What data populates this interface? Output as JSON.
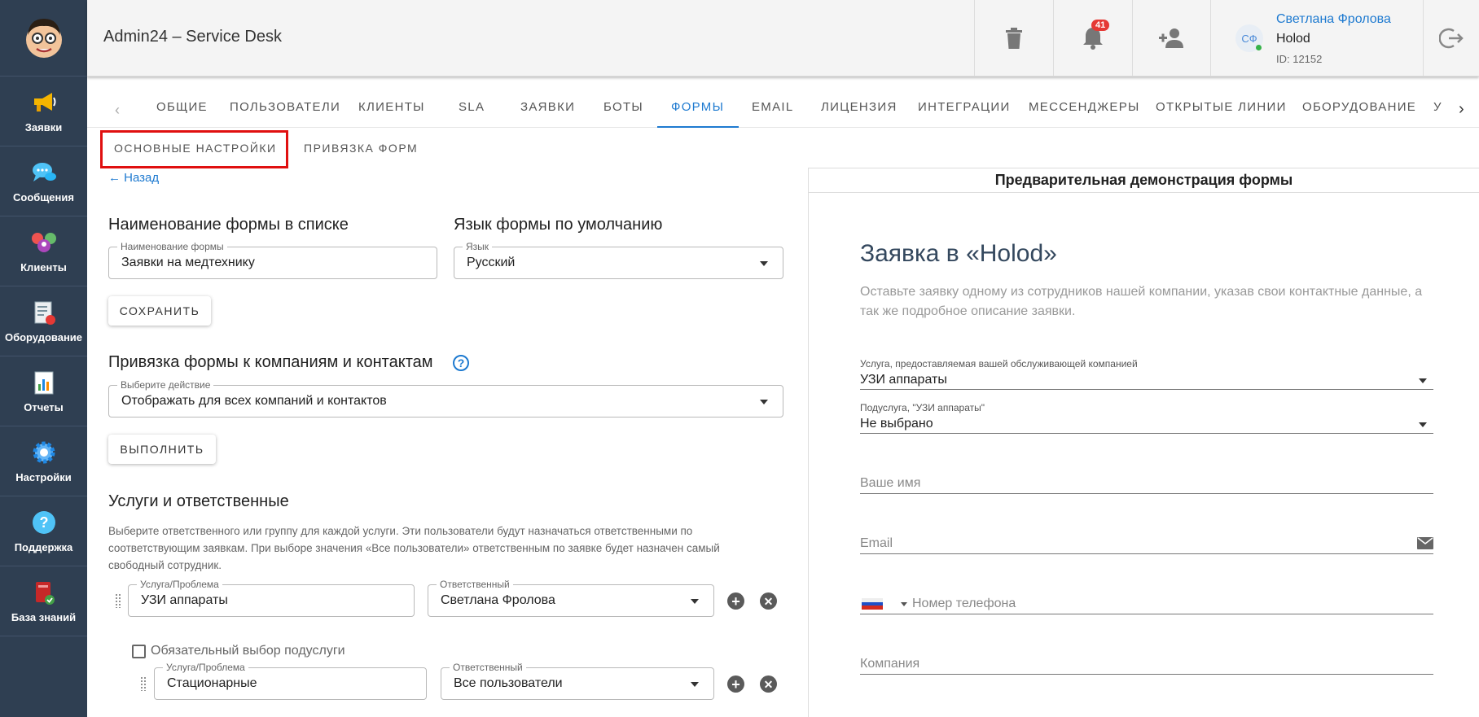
{
  "header": {
    "app_title": "Admin24 – Service Desk",
    "notifications_count": "41",
    "user": {
      "initials": "СФ",
      "name": "Светлана Фролова",
      "company": "Holod",
      "id": "ID: 12152"
    }
  },
  "sidebar": {
    "items": [
      {
        "label": "Заявки",
        "icon": "megaphone-icon"
      },
      {
        "label": "Сообщения",
        "icon": "chat-icon"
      },
      {
        "label": "Клиенты",
        "icon": "clients-icon"
      },
      {
        "label": "Оборудование",
        "icon": "equipment-icon"
      },
      {
        "label": "Отчеты",
        "icon": "reports-icon"
      },
      {
        "label": "Настройки",
        "icon": "gear-icon"
      },
      {
        "label": "Поддержка",
        "icon": "help-icon"
      },
      {
        "label": "База знаний",
        "icon": "book-icon"
      }
    ]
  },
  "tabs": [
    "ОБЩИЕ",
    "ПОЛЬЗОВАТЕЛИ",
    "КЛИЕНТЫ",
    "SLA",
    "ЗАЯВКИ",
    "БОТЫ",
    "ФОРМЫ",
    "EMAIL",
    "ЛИЦЕНЗИЯ",
    "ИНТЕГРАЦИИ",
    "МЕССЕНДЖЕРЫ",
    "ОТКРЫТЫЕ ЛИНИИ",
    "ОБОРУДОВАНИЕ",
    "У"
  ],
  "active_tab": "ФОРМЫ",
  "subtabs": [
    "ОСНОВНЫЕ НАСТРОЙКИ",
    "ПРИВЯЗКА ФОРМ"
  ],
  "back_label": "Назад",
  "form": {
    "name_heading": "Наименование формы в списке",
    "name_label": "Наименование формы",
    "name_value": "Заявки на медтехнику",
    "lang_heading": "Язык формы по умолчанию",
    "lang_label": "Язык",
    "lang_value": "Русский",
    "save_label": "СОХРАНИТЬ",
    "binding_heading": "Привязка формы к компаниям и контактам",
    "action_label": "Выберите действие",
    "action_value": "Отображать для всех компаний и контактов",
    "execute_label": "ВЫПОЛНИТЬ",
    "services_heading": "Услуги и ответственные",
    "services_desc": "Выберите ответственного или группу для каждой услуги. Эти пользователи будут назначаться ответственными по соответствующим заявкам. При выборе значения «Все пользователи» ответственным по заявке будет назначен самый свободный сотрудник.",
    "service_label": "Услуга/Проблема",
    "responsible_label": "Ответственный",
    "service1": "УЗИ аппараты",
    "responsible1": "Светлана Фролова",
    "required_sub_label": "Обязательный выбор подуслуги",
    "service2": "Стационарные",
    "responsible2": "Все пользователи"
  },
  "preview": {
    "header": "Предварительная демонстрация формы",
    "title": "Заявка в «Holod»",
    "intro": "Оставьте заявку одному из сотрудников нашей компании, указав свои контактные данные, а так же подробное описание заявки.",
    "service_label": "Услуга, предоставляемая вашей обслуживающей компанией",
    "service_value": "УЗИ аппараты",
    "subservice_label": "Подуслуга, \"УЗИ аппараты\"",
    "subservice_value": "Не выбрано",
    "name_ph": "Ваше имя",
    "email_ph": "Email",
    "phone_ph": "Номер телефона",
    "company_ph": "Компания"
  }
}
